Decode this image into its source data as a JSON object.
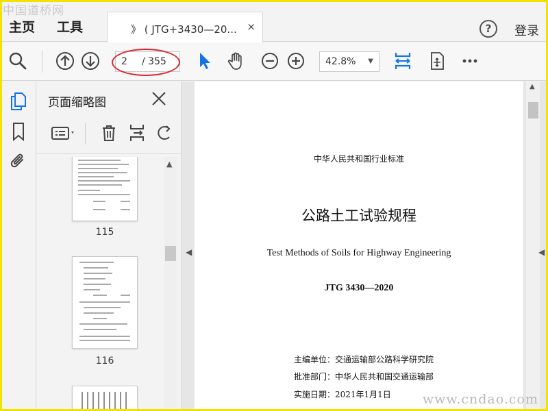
{
  "watermarks": {
    "top": "中国道桥网",
    "bottom": "www.cndao.com"
  },
  "menu": {
    "home": "主页",
    "tools": "工具"
  },
  "tab": {
    "label": "》 ( JTG+3430—20...",
    "close": "×"
  },
  "header": {
    "help": "?",
    "login": "登录"
  },
  "toolbar": {
    "page_current": "2",
    "page_total": "/ 355",
    "zoom": "42.8%"
  },
  "panel": {
    "title": "页面缩略图",
    "thumbnails": [
      {
        "label": "115"
      },
      {
        "label": "116"
      }
    ]
  },
  "document": {
    "standard": "中华人民共和国行业标准",
    "title": "公路土工试验规程",
    "title_en": "Test Methods of Soils for Highway Engineering",
    "code": "JTG 3430—2020",
    "editor": "主编单位：交通运输部公路科学研究院",
    "approver": "批准部门：中华人民共和国交通运输部",
    "effective": "实施日期：2021年1月1日"
  },
  "colors": {
    "accent": "#1473e6",
    "highlight": "#d9262a",
    "frame": "#f3e200"
  },
  "icons": [
    "search-icon",
    "arrow-up-icon",
    "arrow-down-icon",
    "pointer-icon",
    "hand-icon",
    "zoom-out-icon",
    "zoom-in-icon",
    "fit-page-icon",
    "scroll-mode-icon",
    "more-icon",
    "help-icon",
    "thumbnails-icon",
    "bookmark-icon",
    "attachment-icon",
    "options-icon",
    "delete-icon",
    "insert-page-icon",
    "rotate-icon",
    "close-icon"
  ]
}
